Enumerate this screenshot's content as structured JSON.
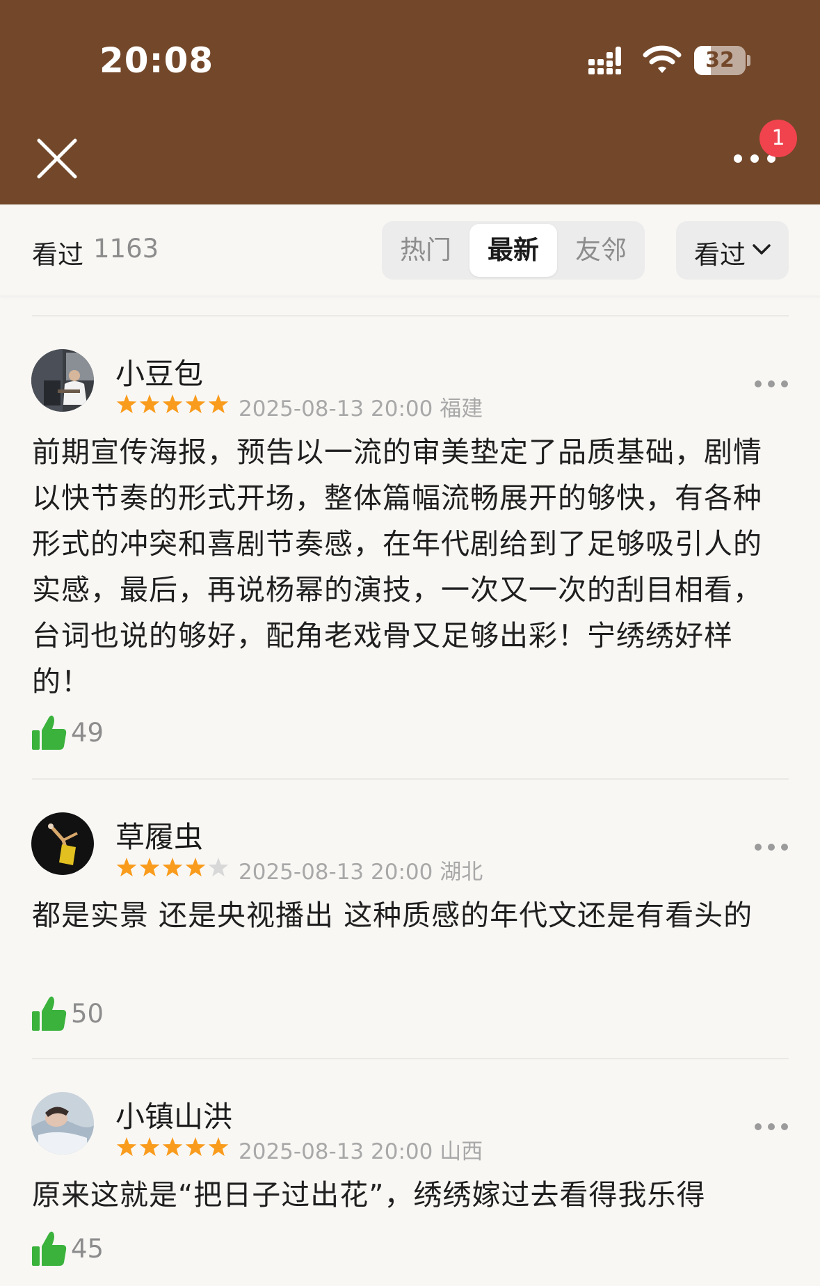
{
  "status_bar": {
    "time": "20:08",
    "battery": "32",
    "battery_level": 0.32,
    "signal_icon": "signal-icon",
    "wifi_icon": "wifi-icon"
  },
  "nav": {
    "close_icon": "close-icon",
    "more_icon": "more-icon",
    "notification_count": "1"
  },
  "filter": {
    "seen_label": "看过",
    "seen_count": "1163",
    "tabs": [
      {
        "label": "热门",
        "active": false
      },
      {
        "label": "最新",
        "active": true
      },
      {
        "label": "友邻",
        "active": false
      }
    ],
    "dropdown_label": "看过",
    "dropdown_icon": "chevron-down-icon"
  },
  "colors": {
    "header_bg": "#73482a",
    "star_on": "#f99b1c",
    "star_off": "#d8d8d8",
    "like_green": "#3ab23c",
    "badge_red": "#f0434e"
  },
  "reviews": [
    {
      "username": "小豆包",
      "rating": 5,
      "date": "2025-08-13 20:00",
      "location": "福建",
      "content": "前期宣传海报，预告以一流的审美垫定了品质基础，剧情以快节奏的形式开场，整体篇幅流畅展开的够快，有各种形式的冲突和喜剧节奏感，在年代剧给到了足够吸引人的实感，最后，再说杨幂的演技，一次又一次的刮目相看，台词也说的够好，配角老戏骨又足够出彩！宁绣绣好样的！",
      "likes": "49"
    },
    {
      "username": "草履虫",
      "rating": 4,
      "date": "2025-08-13 20:00",
      "location": "湖北",
      "content": "都是实景  还是央视播出 这种质感的年代文还是有看头的",
      "likes": "50"
    },
    {
      "username": "小镇山洪",
      "rating": 5,
      "date": "2025-08-13 20:00",
      "location": "山西",
      "content": "原来这就是“把日子过出花”，绣绣嫁过去看得我乐得",
      "likes": "45"
    }
  ]
}
